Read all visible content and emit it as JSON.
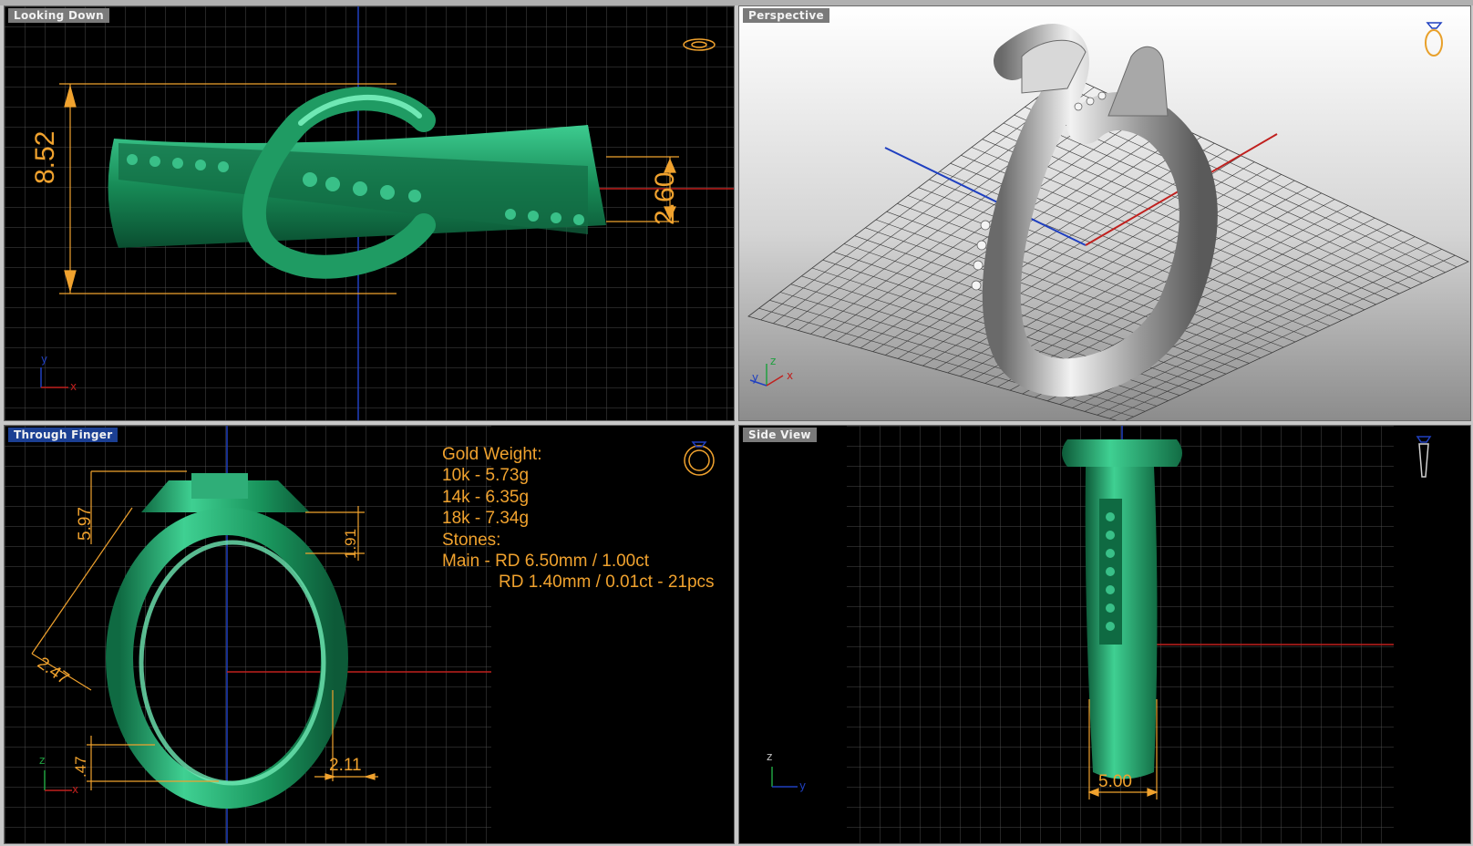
{
  "viewports": {
    "top": {
      "title": "Looking Down",
      "dims": {
        "width": "8.52",
        "height": "2.60"
      }
    },
    "perspective": {
      "title": "Perspective"
    },
    "front": {
      "title": "Through Finger",
      "dims": {
        "d1": "5.97",
        "d2": "1.91",
        "d3": "2.47",
        "d4": ".47",
        "d5": "2.11"
      },
      "info": {
        "gold_title": "Gold Weight:",
        "k10": "10k - 5.73g",
        "k14": "14k - 6.35g",
        "k18": "18k - 7.34g",
        "stones_title": "Stones:",
        "main": "Main - RD 6.50mm / 1.00ct",
        "side": "RD 1.40mm / 0.01ct - 21pcs"
      }
    },
    "side": {
      "title": "Side View",
      "dims": {
        "width": "5.00"
      }
    }
  },
  "axes": {
    "x": "x",
    "y": "y",
    "z": "z"
  },
  "colors": {
    "viewport_bg": "#000000",
    "grid": "#4a4a4a",
    "ring": "#1a8a5a",
    "dimension": "#f0a22e",
    "active_title": "#1b3f93",
    "axis_x": "#c0201e",
    "axis_y": "#2040c0",
    "axis_z": "#20a040"
  }
}
